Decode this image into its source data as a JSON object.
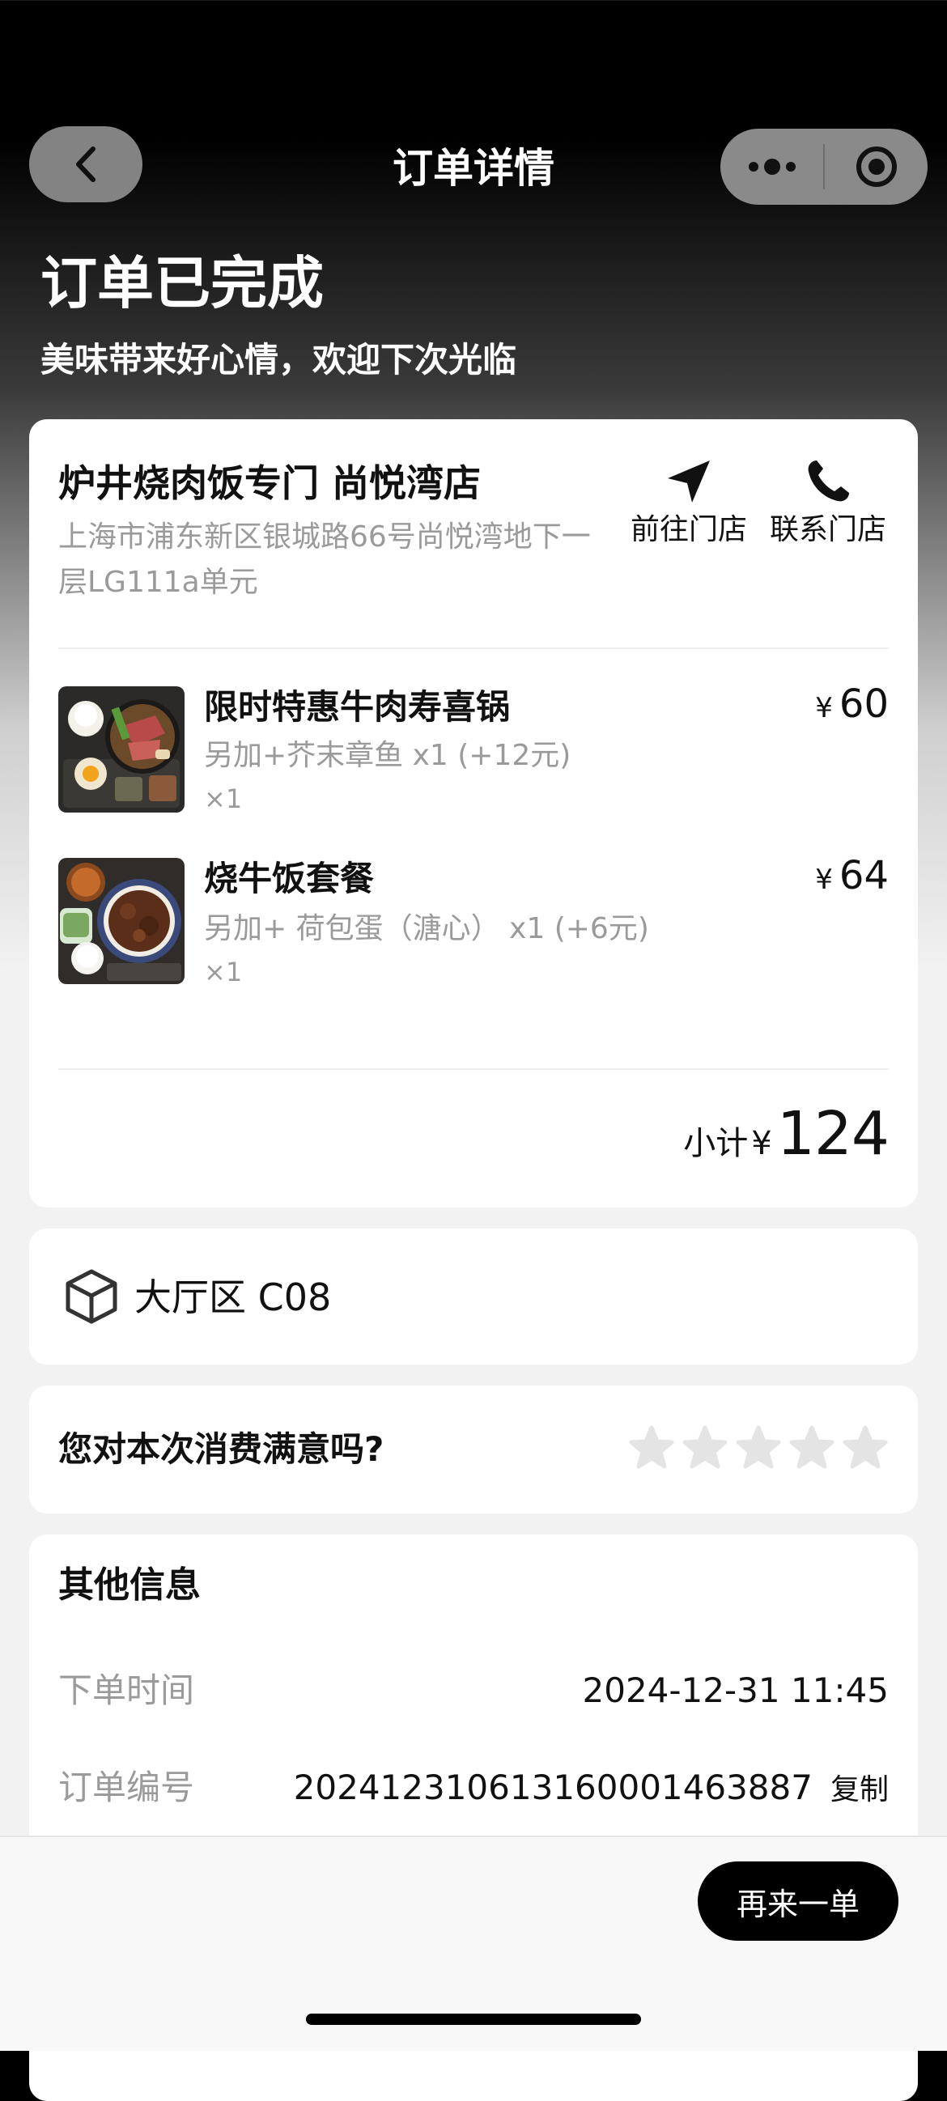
{
  "nav": {
    "title": "订单详情",
    "back_icon": "chevron-left-icon",
    "more_icon": "more-dots-icon",
    "close_icon": "target-circle-icon"
  },
  "status": {
    "title": "订单已完成",
    "subtitle": "美味带来好心情，欢迎下次光临"
  },
  "store": {
    "name": "炉井烧肉饭专门 尚悦湾店",
    "address": "上海市浦东新区银城路66号尚悦湾地下一层LG111a单元",
    "navigate_label": "前往门店",
    "navigate_icon": "navigation-arrow-icon",
    "call_label": "联系门店",
    "call_icon": "phone-icon"
  },
  "items": [
    {
      "name": "限时特惠牛肉寿喜锅",
      "option": "另加+芥末章鱼 x1 (+12元)",
      "qty": "×1",
      "currency": "¥",
      "price": "60"
    },
    {
      "name": "烧牛饭套餐",
      "option": "另加+ 荷包蛋（溏心） x1 (+6元)",
      "qty": "×1",
      "currency": "¥",
      "price": "64"
    }
  ],
  "subtotal": {
    "label": "小计",
    "currency": "¥",
    "value": "124"
  },
  "table": {
    "label": "大厅区 C08",
    "icon": "cube-icon"
  },
  "rating": {
    "question": "您对本次消费满意吗?",
    "max": 5,
    "value": 0
  },
  "other_info": {
    "title": "其他信息",
    "order_time_label": "下单时间",
    "order_time": "2024-12-31 11:45",
    "order_no_label": "订单编号",
    "order_no": "202412310613160001463887",
    "copy_label": "复制"
  },
  "footer": {
    "reorder_label": "再来一单"
  }
}
